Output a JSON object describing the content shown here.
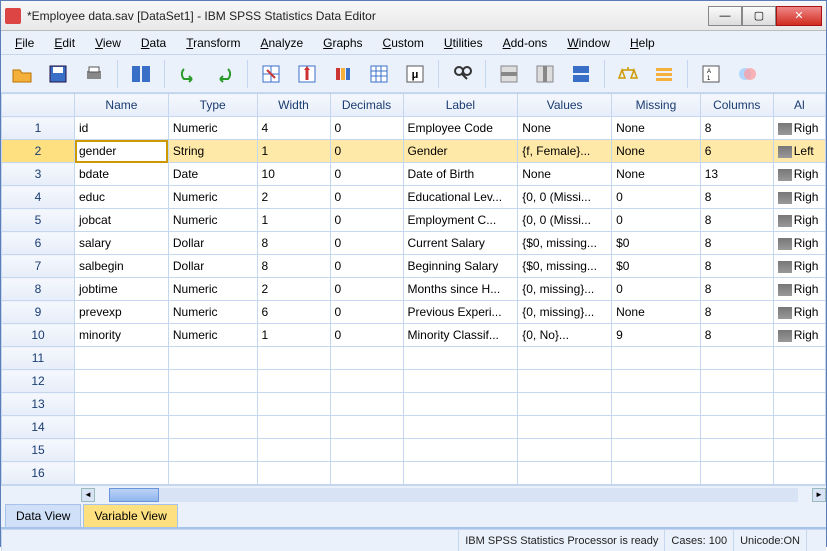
{
  "window": {
    "title": "*Employee data.sav [DataSet1] - IBM SPSS Statistics Data Editor"
  },
  "menus": [
    "File",
    "Edit",
    "View",
    "Data",
    "Transform",
    "Analyze",
    "Graphs",
    "Custom",
    "Utilities",
    "Add-ons",
    "Window",
    "Help"
  ],
  "columns": [
    "Name",
    "Type",
    "Width",
    "Decimals",
    "Label",
    "Values",
    "Missing",
    "Columns",
    "Al"
  ],
  "rows": [
    {
      "n": "1",
      "name": "id",
      "type": "Numeric",
      "width": "4",
      "dec": "0",
      "label": "Employee Code",
      "values": "None",
      "missing": "None",
      "cols": "8",
      "align": "Righ"
    },
    {
      "n": "2",
      "name": "gender",
      "type": "String",
      "width": "1",
      "dec": "0",
      "label": "Gender",
      "values": "{f, Female}...",
      "missing": "None",
      "cols": "6",
      "align": "Left",
      "selected": true
    },
    {
      "n": "3",
      "name": "bdate",
      "type": "Date",
      "width": "10",
      "dec": "0",
      "label": "Date of Birth",
      "values": "None",
      "missing": "None",
      "cols": "13",
      "align": "Righ"
    },
    {
      "n": "4",
      "name": "educ",
      "type": "Numeric",
      "width": "2",
      "dec": "0",
      "label": "Educational Lev...",
      "values": "{0, 0 (Missi...",
      "missing": "0",
      "cols": "8",
      "align": "Righ"
    },
    {
      "n": "5",
      "name": "jobcat",
      "type": "Numeric",
      "width": "1",
      "dec": "0",
      "label": "Employment C...",
      "values": "{0, 0 (Missi...",
      "missing": "0",
      "cols": "8",
      "align": "Righ"
    },
    {
      "n": "6",
      "name": "salary",
      "type": "Dollar",
      "width": "8",
      "dec": "0",
      "label": "Current Salary",
      "values": "{$0, missing...",
      "missing": "$0",
      "cols": "8",
      "align": "Righ"
    },
    {
      "n": "7",
      "name": "salbegin",
      "type": "Dollar",
      "width": "8",
      "dec": "0",
      "label": "Beginning Salary",
      "values": "{$0, missing...",
      "missing": "$0",
      "cols": "8",
      "align": "Righ"
    },
    {
      "n": "8",
      "name": "jobtime",
      "type": "Numeric",
      "width": "2",
      "dec": "0",
      "label": "Months since H...",
      "values": "{0, missing}...",
      "missing": "0",
      "cols": "8",
      "align": "Righ"
    },
    {
      "n": "9",
      "name": "prevexp",
      "type": "Numeric",
      "width": "6",
      "dec": "0",
      "label": "Previous Experi...",
      "values": "{0, missing}...",
      "missing": "None",
      "cols": "8",
      "align": "Righ"
    },
    {
      "n": "10",
      "name": "minority",
      "type": "Numeric",
      "width": "1",
      "dec": "0",
      "label": "Minority Classif...",
      "values": "{0, No}...",
      "missing": "9",
      "cols": "8",
      "align": "Righ"
    }
  ],
  "emptyRows": [
    "11",
    "12",
    "13",
    "14",
    "15",
    "16"
  ],
  "tabs": {
    "data": "Data View",
    "variable": "Variable View"
  },
  "status": {
    "proc": "IBM SPSS Statistics Processor is ready",
    "cases": "Cases: 100",
    "unicode": "Unicode:ON"
  }
}
